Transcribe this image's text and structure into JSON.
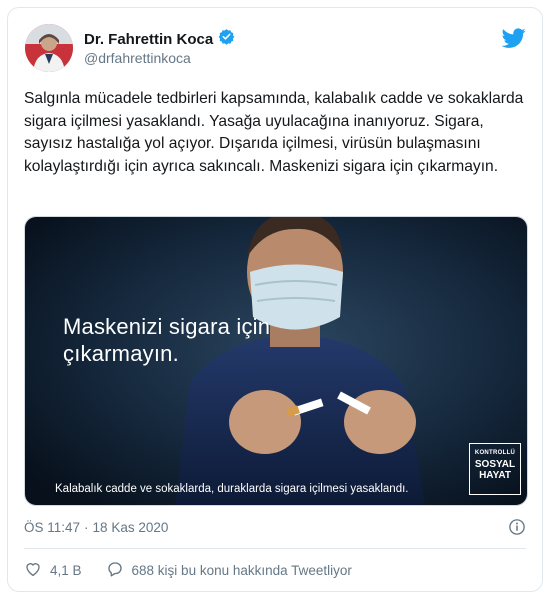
{
  "author": {
    "name": "Dr. Fahrettin Koca",
    "handle": "@drfahrettinkoca"
  },
  "tweet": {
    "text": "Salgınla mücadele tedbirleri kapsamında, kalabalık cadde ve sokaklarda sigara içilmesi yasaklandı. Yasağa uyulacağına inanıyoruz. Sigara, sayısız hastalığa yol açıyor. Dışarıda içilmesi, virüsün bulaşmasını kolaylaştırdığı için ayrıca sakıncalı. Maskenizi sigara için çıkarmayın."
  },
  "media": {
    "headline_line1": "Maskenizi sigara için",
    "headline_line2": "çıkarmayın.",
    "caption": "Kalabalık cadde ve sokaklarda, duraklarda sigara içilmesi yasaklandı.",
    "badge": {
      "line1": "KONTROLLÜ",
      "line2": "SOSYAL",
      "line3": "HAYAT"
    }
  },
  "meta": {
    "time": "ÖS 11:47",
    "separator": "·",
    "date": "18 Kas 2020"
  },
  "actions": {
    "likes": "4,1 B",
    "talking": "688 kişi bu konu hakkında Tweetliyor"
  },
  "colors": {
    "verified": "#1da1f2",
    "twitter": "#1da1f2",
    "secondary_text": "#657786"
  }
}
